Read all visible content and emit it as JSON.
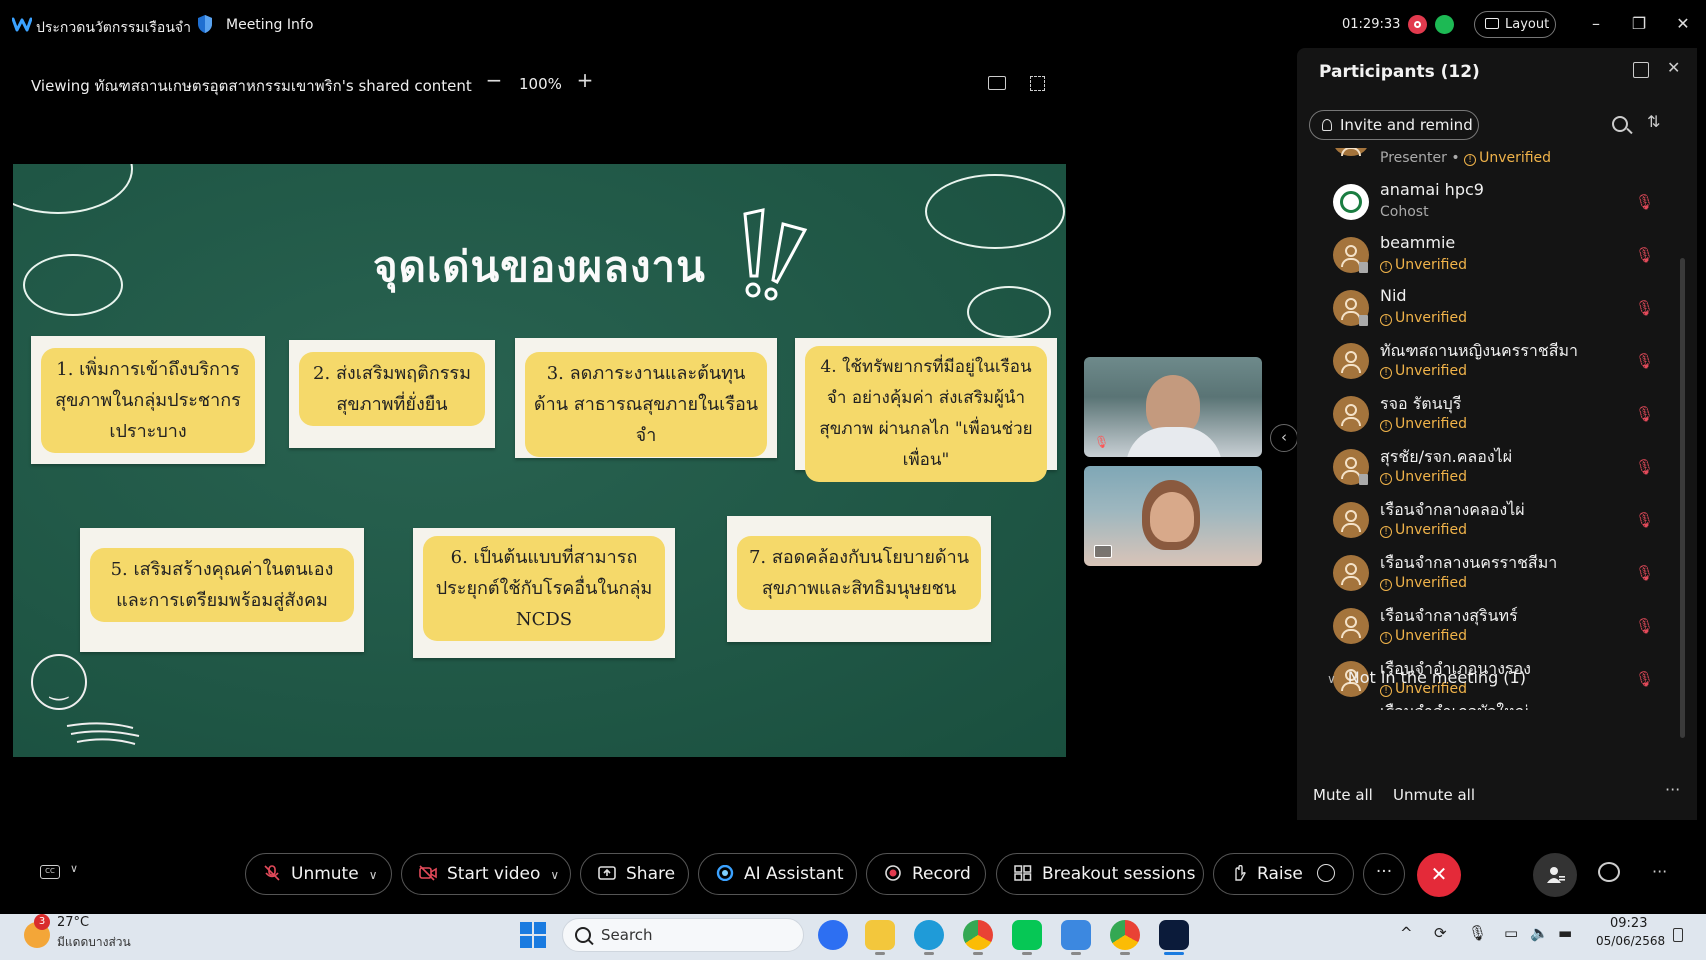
{
  "titlebar": {
    "app_title": "ประกวดนวัตกรรมเรือนจำ",
    "meeting_info": "Meeting Info",
    "elapsed": "01:29:33",
    "layout_label": "Layout"
  },
  "viewbar": {
    "viewing_text": "Viewing ทัณฑสถานเกษตรอุตสาหกรรมเขาพริก's shared content",
    "zoom": "100%"
  },
  "slide": {
    "title": "จุดเด่นของผลงาน",
    "items": [
      "1. เพิ่มการเข้าถึงบริการ สุขภาพในกลุ่มประชากร เปราะบาง",
      "2. ส่งเสริมพฤติกรรม สุขภาพที่ยั่งยืน",
      "3. ลดภาระงานและต้นทุนด้าน สาธารณสุขภายในเรือนจำ",
      "4. ใช้ทรัพยากรที่มีอยู่ในเรือนจำ อย่างคุ้มค่า ส่งเสริมผู้นำสุขภาพ ผ่านกลไก \"เพื่อนช่วยเพื่อน\"",
      "5. เสริมสร้างคุณค่าในตนเอง และการเตรียมพร้อมสู่สังคม",
      "6. เป็นต้นแบบที่สามารถ ประยุกต์ใช้กับโรคอื่นในกลุ่ม NCDS",
      "7. สอดคล้องกับนโยบายด้าน สุขภาพและสิทธิมนุษยชน"
    ]
  },
  "participants": {
    "title": "Participants (12)",
    "invite_label": "Invite and remind",
    "presenter_role": "Presenter",
    "presenter_status": "Unverified",
    "rows": [
      {
        "name": "anamai hpc9",
        "sub": "Cohost"
      },
      {
        "name": "beammie",
        "sub": "Unverified"
      },
      {
        "name": "Nid",
        "sub": "Unverified"
      },
      {
        "name": "ทัณฑสถานหญิงนครราชสีมา",
        "sub": "Unverified"
      },
      {
        "name": "รจอ รัตนบุรี",
        "sub": "Unverified"
      },
      {
        "name": "สุรชัย/รจก.คลองไผ่",
        "sub": "Unverified"
      },
      {
        "name": "เรือนจำกลางคลองไผ่",
        "sub": "Unverified"
      },
      {
        "name": "เรือนจำกลางนครราชสีมา",
        "sub": "Unverified"
      },
      {
        "name": "เรือนจำกลางสุรินทร์",
        "sub": "Unverified"
      },
      {
        "name": "เรือนจำอำเภอนางรอง",
        "sub": "Unverified"
      }
    ],
    "not_in_meeting": "Not in the meeting (1)",
    "not_in_meeting_peek": "เรือนจำอำเภอบัวใหญ่",
    "mute_all": "Mute all",
    "unmute_all": "Unmute all"
  },
  "toolbar": {
    "unmute": "Unmute",
    "start_video": "Start video",
    "share": "Share",
    "ai_assistant": "AI Assistant",
    "record": "Record",
    "breakout": "Breakout sessions",
    "raise": "Raise"
  },
  "taskbar": {
    "weather_badge": "3",
    "temperature": "27°C",
    "weather_desc": "มีแดดบางส่วน",
    "search_label": "Search",
    "time": "09:23",
    "date": "05/06/2568"
  },
  "colors": {
    "slide_bg": "#1d5a47",
    "note_highlight": "#f5d96a",
    "leave_red": "#e42a39",
    "unverified_amber": "#f0b34a"
  }
}
